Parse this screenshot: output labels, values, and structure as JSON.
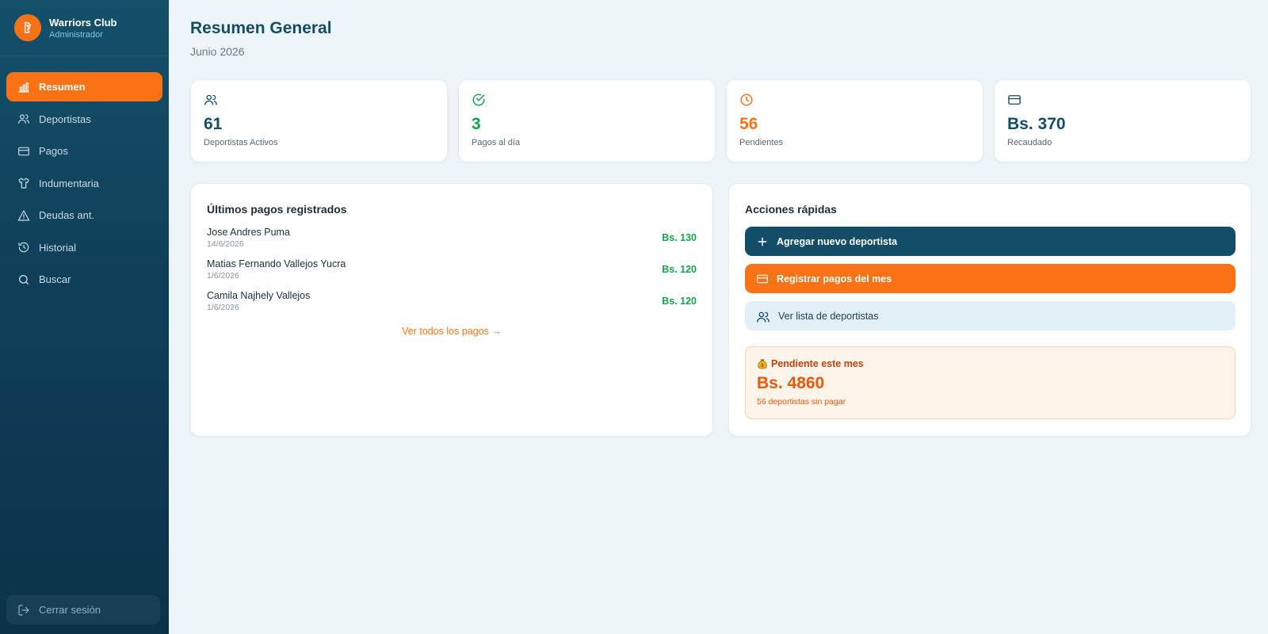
{
  "app": {
    "name": "Warriors Club",
    "role": "Administrador"
  },
  "sidebar": {
    "items": [
      {
        "label": "Resumen",
        "icon": "bar-chart-icon",
        "active": true
      },
      {
        "label": "Deportistas",
        "icon": "users-icon"
      },
      {
        "label": "Pagos",
        "icon": "credit-card-icon"
      },
      {
        "label": "Indumentaria",
        "icon": "shirt-icon"
      },
      {
        "label": "Deudas ant.",
        "icon": "alert-triangle-icon"
      },
      {
        "label": "Historial",
        "icon": "history-icon"
      },
      {
        "label": "Buscar",
        "icon": "search-icon"
      }
    ],
    "logout_label": "Cerrar sesión"
  },
  "header": {
    "title": "Resumen General",
    "subtitle": "Junio 2026"
  },
  "stats": [
    {
      "value": "61",
      "label": "Deportistas Activos",
      "icon": "users-icon",
      "color": "#134d68"
    },
    {
      "value": "3",
      "label": "Pagos al día",
      "icon": "check-circle-icon",
      "color": "#16a34a"
    },
    {
      "value": "56",
      "label": "Pendientes",
      "icon": "clock-icon",
      "color": "#f97316"
    },
    {
      "value": "Bs. 370",
      "label": "Recaudado",
      "icon": "credit-card-icon",
      "color": "#134d68"
    }
  ],
  "recent_payments": {
    "title": "Últimos pagos registrados",
    "rows": [
      {
        "name": "Jose Andres Puma",
        "date": "14/6/2026",
        "amount": "Bs. 130"
      },
      {
        "name": "Matias Fernando Vallejos Yucra",
        "date": "1/6/2026",
        "amount": "Bs. 120"
      },
      {
        "name": "Camila Najhely Vallejos",
        "date": "1/6/2026",
        "amount": "Bs. 120"
      }
    ],
    "see_all_label": "Ver todos los pagos →"
  },
  "quick_actions": {
    "title": "Acciones rápidas",
    "add_athlete_label": "Agregar nuevo deportista",
    "register_payments_label": "Registrar pagos del mes",
    "view_list_label": "Ver lista de deportistas"
  },
  "pending_month": {
    "title": "Pendiente este mes",
    "amount": "Bs. 4860",
    "subtitle": "56 deportistas sin pagar"
  },
  "colors": {
    "brand_dark": "#134d68",
    "accent": "#f97316",
    "success": "#16a34a"
  }
}
